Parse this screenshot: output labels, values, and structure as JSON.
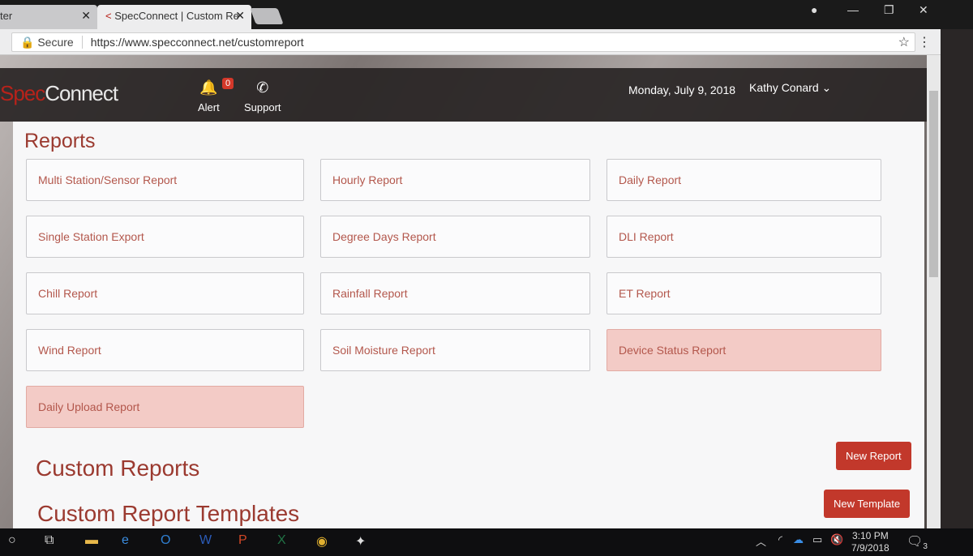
{
  "browser": {
    "tabs": [
      {
        "title": "ter"
      },
      {
        "title": "SpecConnect | Custom Re"
      }
    ],
    "secure_label": "Secure",
    "url": "https://www.specconnect.net/customreport"
  },
  "header": {
    "logo_spec": "Spec",
    "logo_connect": "Connect",
    "alert_label": "Alert",
    "alert_count": "0",
    "support_label": "Support",
    "date": "Monday, July 9, 2018",
    "user": "Kathy Conard"
  },
  "reports": {
    "title": "Reports",
    "items": [
      {
        "label": "Multi Station/Sensor Report",
        "highlighted": false
      },
      {
        "label": "Hourly Report",
        "highlighted": false
      },
      {
        "label": "Daily Report",
        "highlighted": false
      },
      {
        "label": "Single Station Export",
        "highlighted": false
      },
      {
        "label": "Degree Days Report",
        "highlighted": false
      },
      {
        "label": "DLI Report",
        "highlighted": false
      },
      {
        "label": "Chill Report",
        "highlighted": false
      },
      {
        "label": "Rainfall Report",
        "highlighted": false
      },
      {
        "label": "ET Report",
        "highlighted": false
      },
      {
        "label": "Wind Report",
        "highlighted": false
      },
      {
        "label": "Soil Moisture Report",
        "highlighted": false
      },
      {
        "label": "Device Status Report",
        "highlighted": true
      },
      {
        "label": "Daily Upload Report",
        "highlighted": true
      }
    ]
  },
  "custom_reports": {
    "title": "Custom Reports",
    "new_button": "New Report"
  },
  "custom_templates": {
    "title": "Custom Report Templates",
    "new_button": "New Template"
  },
  "taskbar": {
    "time": "3:10 PM",
    "date": "7/9/2018",
    "notifications": "3"
  },
  "colors": {
    "accent": "#c2382b",
    "heading": "#9b3a30",
    "highlight": "#f3cbc6"
  }
}
